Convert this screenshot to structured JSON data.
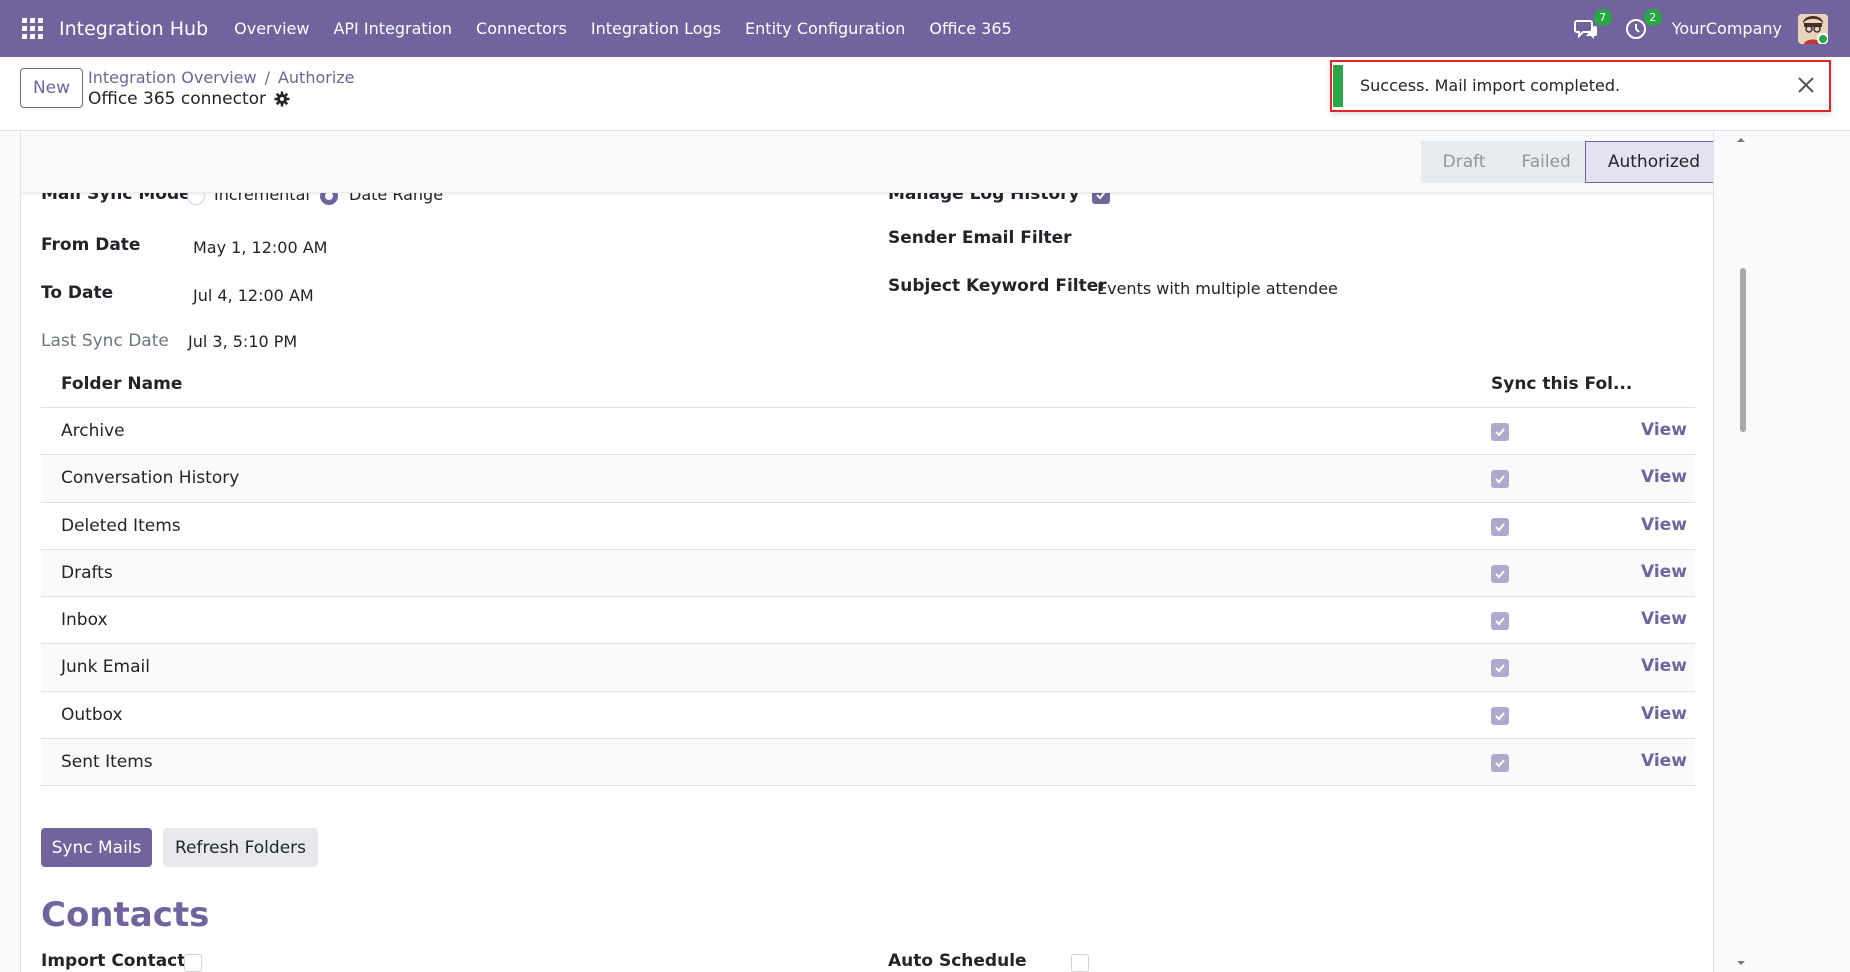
{
  "navbar": {
    "brand": "Integration Hub",
    "menu": [
      "Overview",
      "API Integration",
      "Connectors",
      "Integration Logs",
      "Entity Configuration",
      "Office 365"
    ],
    "messages_count": "7",
    "activities_count": "2",
    "company": "YourCompany"
  },
  "control": {
    "new_label": "New",
    "breadcrumb": [
      "Integration Overview",
      "Authorize"
    ],
    "record_title": "Office 365 connector"
  },
  "notification": {
    "message": "Success. Mail import completed."
  },
  "statusbar": {
    "steps": [
      "Draft",
      "Failed",
      "Authorized"
    ],
    "active": "Authorized"
  },
  "form": {
    "mail_sync_mode_label": "Mail Sync Mode",
    "mode_options": [
      "Incremental",
      "Date Range"
    ],
    "mode_selected": "Date Range",
    "from_date_label": "From Date",
    "from_date_value": "May 1, 12:00 AM",
    "to_date_label": "To Date",
    "to_date_value": "Jul 4, 12:00 AM",
    "last_sync_label": "Last Sync Date",
    "last_sync_value": "Jul 3, 5:10 PM",
    "manage_log_label": "Manage Log History",
    "sender_filter_label": "Sender Email Filter",
    "sender_filter_value": "",
    "subject_filter_label": "Subject Keyword Filter",
    "subject_filter_value": "Events with multiple attendee"
  },
  "folders": {
    "headers": [
      "Folder Name",
      "Sync this Fol..."
    ],
    "view_label": "View",
    "rows": [
      "Archive",
      "Conversation History",
      "Deleted Items",
      "Drafts",
      "Inbox",
      "Junk Email",
      "Outbox",
      "Sent Items"
    ]
  },
  "actions": {
    "sync_mails": "Sync Mails",
    "refresh_folders": "Refresh Folders"
  },
  "contacts": {
    "section_title": "Contacts",
    "import_contact_label": "Import Contact",
    "auto_schedule_label": "Auto Schedule"
  },
  "colors": {
    "brand": "#71639e",
    "success": "#28a745",
    "highlight": "#e3242b"
  }
}
